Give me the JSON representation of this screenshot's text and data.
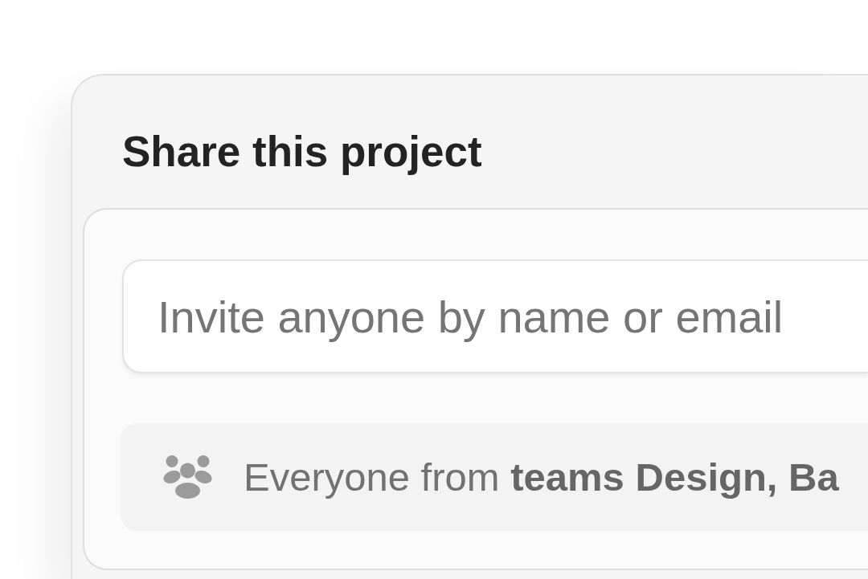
{
  "dialog": {
    "title": "Share this project"
  },
  "invite": {
    "placeholder": "Invite anyone by name or email"
  },
  "team_access": {
    "text": "Everyone from **teams Design, Ba**"
  }
}
